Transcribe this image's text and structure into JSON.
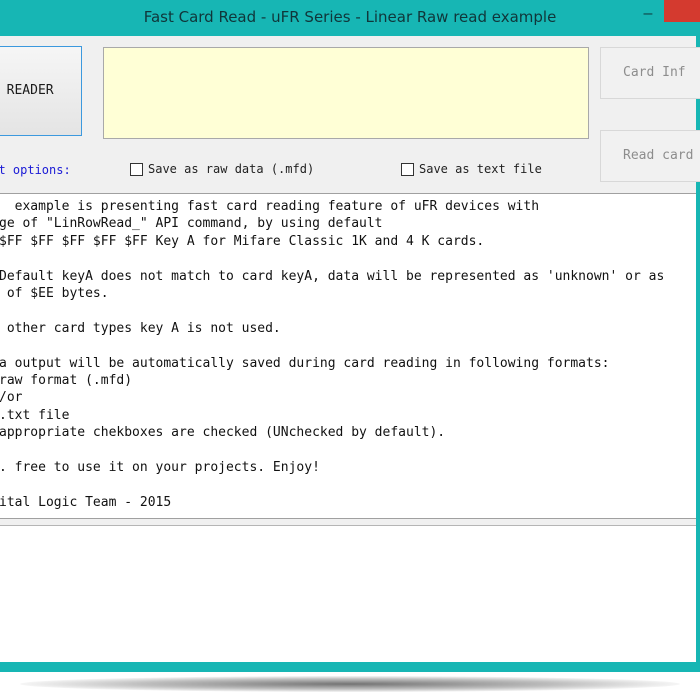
{
  "window": {
    "title": "Fast Card Read - uFR Series - Linear Raw read example",
    "minimize_glyph": "–"
  },
  "toolbar": {
    "open_reader_label": "N READER",
    "card_info_label": "Card Inf",
    "read_card_label": "Read card"
  },
  "options": {
    "label": "put options:",
    "save_raw_label": "Save as raw data (.mfd)",
    "save_text_label": "Save as text file"
  },
  "memo": {
    "lines": [
      "  example is presenting fast card reading feature of uFR devices with",
      "ge of \"LinRowRead_\" API command, by using default",
      "$FF $FF $FF $FF $FF Key A for Mifare Classic 1K and 4 K cards.",
      "",
      "Default keyA does not match to card keyA, data will be represented as 'unknown' or as",
      " of $EE bytes.",
      "",
      " other card types key A is not used.",
      "",
      "a output will be automatically saved during card reading in following formats:",
      "raw format (.mfd)",
      "/or",
      ".txt file",
      "appropriate chekboxes are checked (UNchecked by default).",
      "",
      ". free to use it on your projects. Enjoy!",
      "",
      "ital Logic Team - 2015"
    ]
  },
  "colors": {
    "frame": "#17b6b4",
    "close_button": "#d43a2f",
    "status_background": "#ffffd6",
    "options_label": "#1a1ad6"
  }
}
